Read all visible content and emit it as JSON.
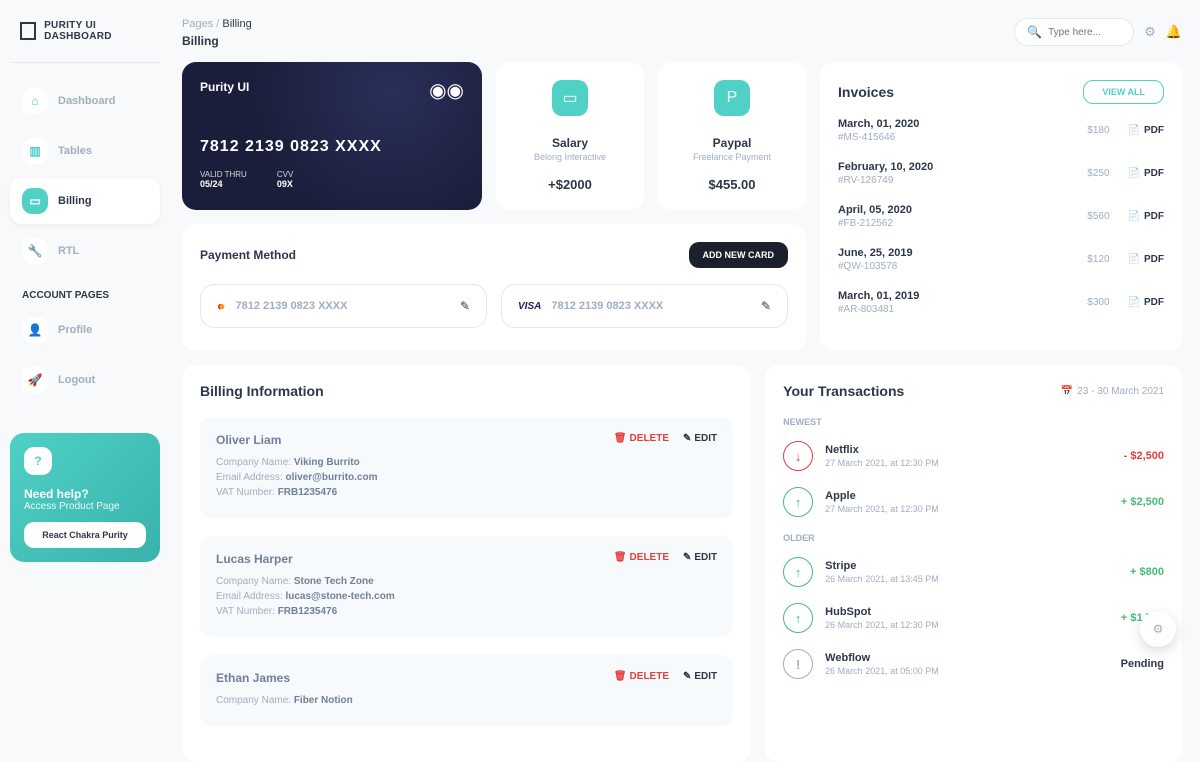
{
  "brand": "PURITY UI DASHBOARD",
  "nav": {
    "dashboard": "Dashboard",
    "tables": "Tables",
    "billing": "Billing",
    "rtl": "RTL"
  },
  "account_section": "ACCOUNT PAGES",
  "account": {
    "profile": "Profile",
    "logout": "Logout"
  },
  "help": {
    "title": "Need help?",
    "sub": "Access Product Page",
    "btn": "React Chakra Purity"
  },
  "breadcrumb": {
    "root": "Pages",
    "sep": "/",
    "current": "Billing"
  },
  "page_title": "Billing",
  "search_placeholder": "Type here...",
  "credit_card": {
    "brand": "Purity UI",
    "number": "7812 2139 0823 XXXX",
    "valid_label": "VALID THRU",
    "valid": "05/24",
    "cvv_label": "CVV",
    "cvv": "09X"
  },
  "stats": {
    "salary": {
      "title": "Salary",
      "sub": "Belong Interactive",
      "value": "+$2000"
    },
    "paypal": {
      "title": "Paypal",
      "sub": "Freelance Payment",
      "value": "$455.00"
    }
  },
  "invoices": {
    "title": "Invoices",
    "view_all": "VIEW ALL",
    "pdf_label": "PDF",
    "items": [
      {
        "date": "March, 01, 2020",
        "id": "#MS-415646",
        "amount": "$180"
      },
      {
        "date": "February, 10, 2020",
        "id": "#RV-126749",
        "amount": "$250"
      },
      {
        "date": "April, 05, 2020",
        "id": "#FB-212562",
        "amount": "$560"
      },
      {
        "date": "June, 25, 2019",
        "id": "#QW-103578",
        "amount": "$120"
      },
      {
        "date": "March, 01, 2019",
        "id": "#AR-803481",
        "amount": "$300"
      }
    ]
  },
  "payment": {
    "title": "Payment Method",
    "add": "ADD NEW CARD",
    "cards": [
      {
        "brand": "mastercard",
        "number": "7812 2139 0823 XXXX"
      },
      {
        "brand": "visa",
        "number": "7812 2139 0823 XXXX"
      }
    ]
  },
  "billing_info": {
    "title": "Billing Information",
    "delete_label": "DELETE",
    "edit_label": "EDIT",
    "company_label": "Company Name:",
    "email_label": "Email Address:",
    "vat_label": "VAT Number:",
    "items": [
      {
        "name": "Oliver Liam",
        "company": "Viking Burrito",
        "email": "oliver@burrito.com",
        "vat": "FRB1235476"
      },
      {
        "name": "Lucas Harper",
        "company": "Stone Tech Zone",
        "email": "lucas@stone-tech.com",
        "vat": "FRB1235476"
      },
      {
        "name": "Ethan James",
        "company": "Fiber Notion",
        "email": "",
        "vat": ""
      }
    ]
  },
  "transactions": {
    "title": "Your Transactions",
    "range": "23 - 30 March 2021",
    "newest_label": "NEWEST",
    "older_label": "OLDER",
    "newest": [
      {
        "name": "Netflix",
        "time": "27 March 2021, at 12:30 PM",
        "amount": "- $2,500",
        "dir": "down"
      },
      {
        "name": "Apple",
        "time": "27 March 2021, at 12:30 PM",
        "amount": "+ $2,500",
        "dir": "up"
      }
    ],
    "older": [
      {
        "name": "Stripe",
        "time": "26 March 2021, at 13:45 PM",
        "amount": "+ $800",
        "dir": "up"
      },
      {
        "name": "HubSpot",
        "time": "26 March 2021, at 12:30 PM",
        "amount": "+ $1,700",
        "dir": "up"
      },
      {
        "name": "Webflow",
        "time": "26 March 2021, at 05:00 PM",
        "amount": "Pending",
        "dir": "pending"
      }
    ]
  }
}
